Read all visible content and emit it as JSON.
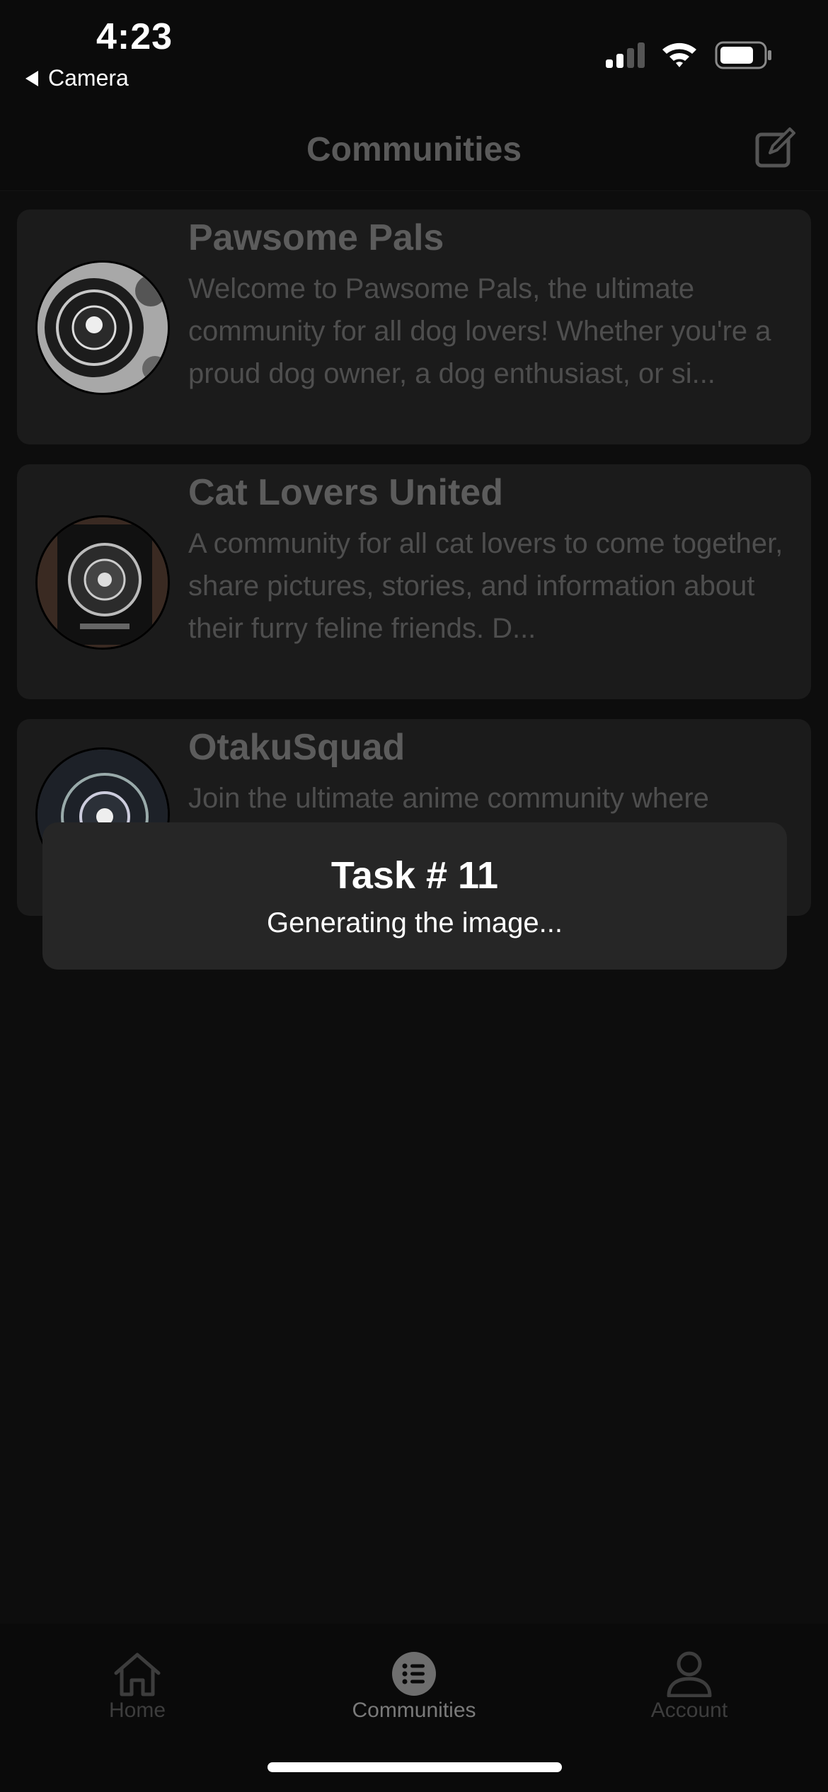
{
  "status_bar": {
    "time": "4:23",
    "back_app": "Camera",
    "icons": [
      "signal-icon",
      "wifi-icon",
      "battery-icon"
    ]
  },
  "nav": {
    "title": "Communities",
    "compose_icon": "compose-icon"
  },
  "communities": [
    {
      "name": "Pawsome Pals",
      "description": "Welcome to Pawsome Pals, the ultimate community for all dog lovers! Whether you're a proud dog owner, a dog enthusiast, or si..."
    },
    {
      "name": "Cat Lovers United",
      "description": "A community for all cat lovers to come together, share pictures, stories, and information about their furry feline friends. D..."
    },
    {
      "name": "OtakuSquad",
      "description": "Join the ultimate anime community where"
    }
  ],
  "toast": {
    "title": "Task # 11",
    "message": "Generating the image..."
  },
  "tabs": [
    {
      "label": "Home",
      "icon": "home-icon",
      "active": false
    },
    {
      "label": "Communities",
      "icon": "list-icon",
      "active": true
    },
    {
      "label": "Account",
      "icon": "person-icon",
      "active": false
    }
  ],
  "colors": {
    "background": "#0d0d0d",
    "card": "#1b1b1b",
    "toast": "#262626",
    "dim_text": "#5c5c5c"
  }
}
